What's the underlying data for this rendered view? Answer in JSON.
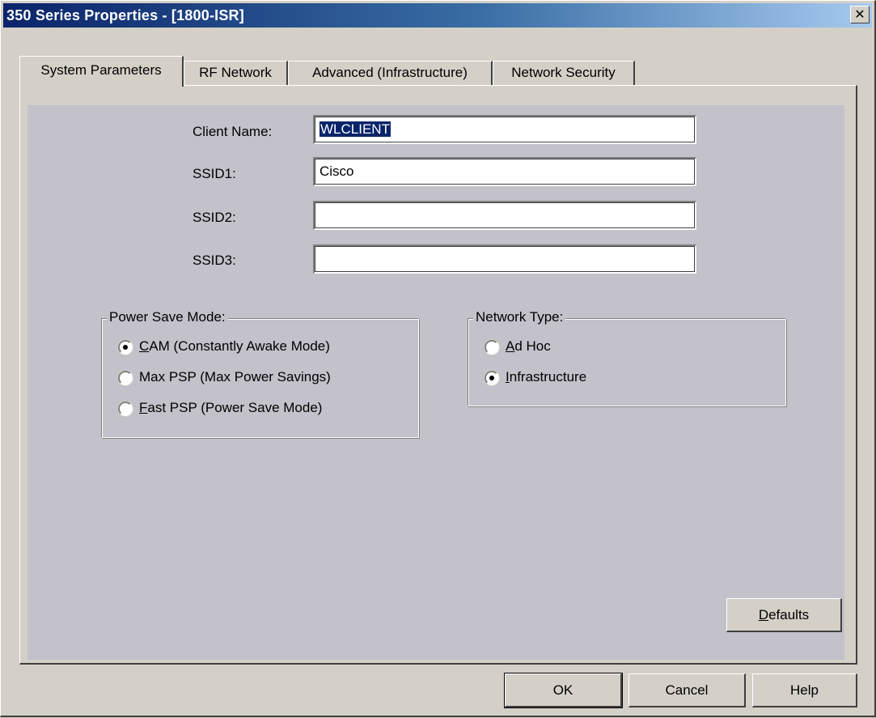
{
  "window": {
    "title": "350 Series Properties - [1800-ISR]"
  },
  "tabs": [
    {
      "label": "System Parameters",
      "active": true
    },
    {
      "label": "RF Network",
      "active": false
    },
    {
      "label": "Advanced (Infrastructure)",
      "active": false
    },
    {
      "label": "Network Security",
      "active": false
    }
  ],
  "fields": {
    "client_name": {
      "label": "Client Name:",
      "value": "WLCLIENT"
    },
    "ssid1": {
      "label": "SSID1:",
      "value": "Cisco"
    },
    "ssid2": {
      "label": "SSID2:",
      "value": ""
    },
    "ssid3": {
      "label": "SSID3:",
      "value": ""
    }
  },
  "power_save": {
    "legend": "Power Save Mode:",
    "options": [
      {
        "mnemonic": "C",
        "rest": "AM (Constantly Awake Mode)",
        "selected": true
      },
      {
        "mnemonic": "",
        "rest": "Max PSP (Max Power Savings)",
        "selected": false
      },
      {
        "mnemonic": "F",
        "rest": "ast PSP (Power Save Mode)",
        "selected": false
      }
    ]
  },
  "network_type": {
    "legend": "Network Type:",
    "options": [
      {
        "mnemonic": "A",
        "rest": "d Hoc",
        "selected": false
      },
      {
        "mnemonic": "I",
        "rest": "nfrastructure",
        "selected": true
      }
    ]
  },
  "buttons": {
    "defaults": {
      "mnemonic": "D",
      "rest": "efaults"
    },
    "ok": "OK",
    "cancel": "Cancel",
    "help": "Help"
  },
  "colors": {
    "dialog_face": "#d4d0c8",
    "title_start": "#0a246a",
    "title_end": "#a6caf0",
    "selection": "#0a246a"
  }
}
